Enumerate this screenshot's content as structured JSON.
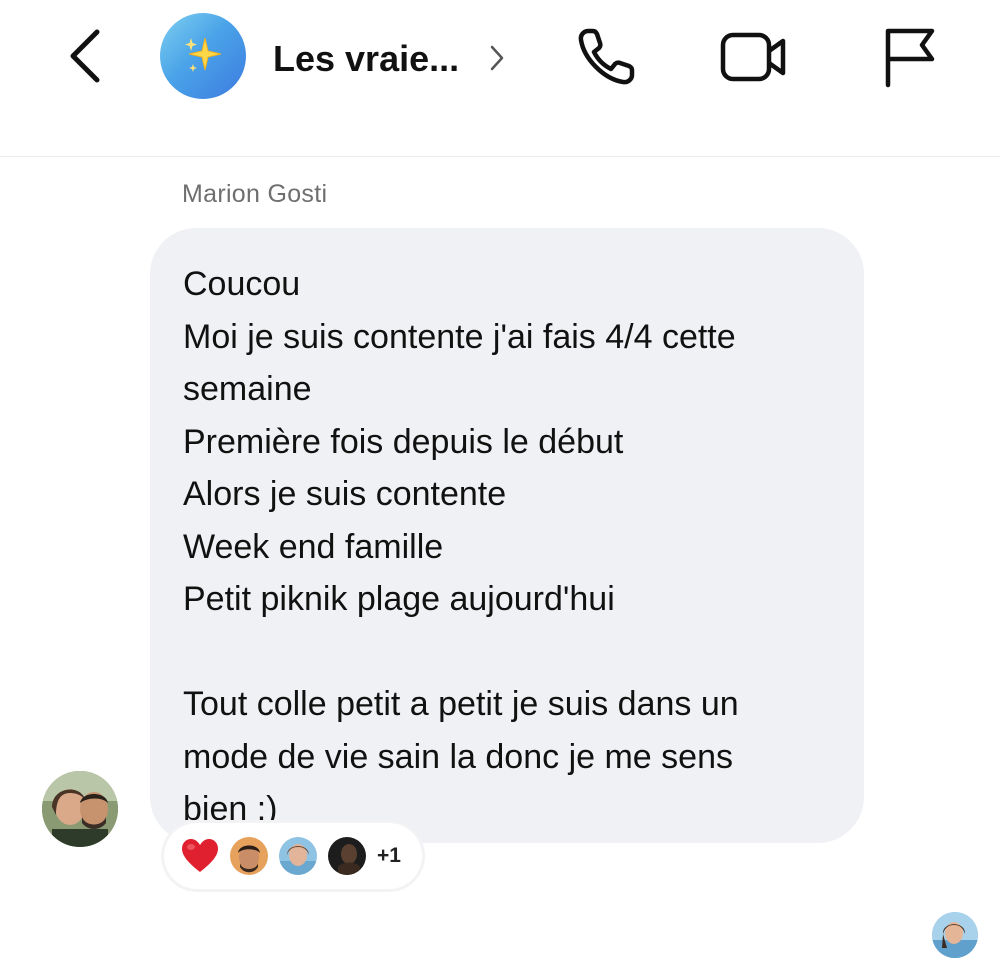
{
  "header": {
    "group_title": "Les vraie...",
    "back_icon": "chevron-left-icon",
    "avatar_icon": "sparkles-icon",
    "title_chevron_icon": "chevron-right-icon",
    "call_icon": "phone-icon",
    "video_icon": "video-camera-icon",
    "report_icon": "flag-icon",
    "avatar_gradient": [
      "#7fd0f0",
      "#3d7be0"
    ]
  },
  "message": {
    "sender": "Marion Gosti",
    "lines": [
      "Coucou",
      "Moi je suis contente j'ai fais 4/4 cette",
      "semaine",
      "Première fois depuis le début",
      "Alors je suis contente",
      "Week end famille",
      "Petit piknik plage aujourd'hui",
      "",
      "Tout colle petit a petit je suis dans un",
      "mode de vie sain la donc je me sens",
      "bien :)"
    ],
    "bubble_color": "#f0f1f4"
  },
  "reactions": {
    "heart_icon": "red-heart-icon",
    "more_count": "+1"
  },
  "colors": {
    "heart": "#e0202e",
    "text": "#111111",
    "sender_label": "#6f6f6f"
  }
}
